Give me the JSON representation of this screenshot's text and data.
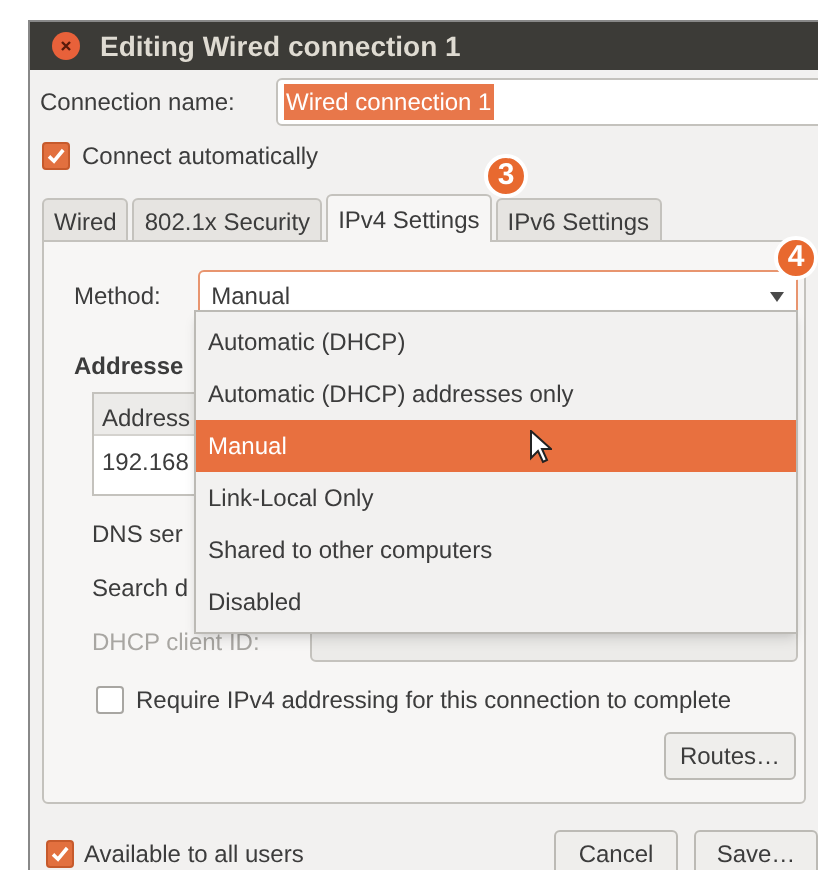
{
  "window": {
    "title": "Editing Wired connection 1"
  },
  "connection_name": {
    "label": "Connection name:",
    "value": "Wired connection 1"
  },
  "connect_automatically": {
    "label": "Connect automatically",
    "checked": true
  },
  "tabs": [
    {
      "label": "Wired",
      "selected": false
    },
    {
      "label": "802.1x Security",
      "selected": false
    },
    {
      "label": "IPv4 Settings",
      "selected": true
    },
    {
      "label": "IPv6 Settings",
      "selected": false
    }
  ],
  "callouts": [
    {
      "label": "3"
    },
    {
      "label": "4"
    }
  ],
  "method": {
    "label": "Method:",
    "value": "Manual",
    "expanded": true,
    "options": [
      {
        "label": "Automatic (DHCP)",
        "selected": false
      },
      {
        "label": "Automatic (DHCP) addresses only",
        "selected": false
      },
      {
        "label": "Manual",
        "selected": true
      },
      {
        "label": "Link-Local Only",
        "selected": false
      },
      {
        "label": "Shared to other computers",
        "selected": false
      },
      {
        "label": "Disabled",
        "selected": false
      }
    ]
  },
  "addresses": {
    "label": "Addresse",
    "column": "Address",
    "row": "192.168"
  },
  "dns_servers": {
    "label": "DNS ser"
  },
  "search_domains": {
    "label": "Search d"
  },
  "dhcp_client_id": {
    "label": "DHCP client ID:",
    "disabled": true
  },
  "require_ipv4": {
    "label": "Require IPv4 addressing for this connection to complete",
    "checked": false
  },
  "routes_button": "Routes…",
  "available_to_all_users": {
    "label": "Available to all users",
    "checked": true
  },
  "buttons": [
    "Cancel",
    "Save…"
  ]
}
